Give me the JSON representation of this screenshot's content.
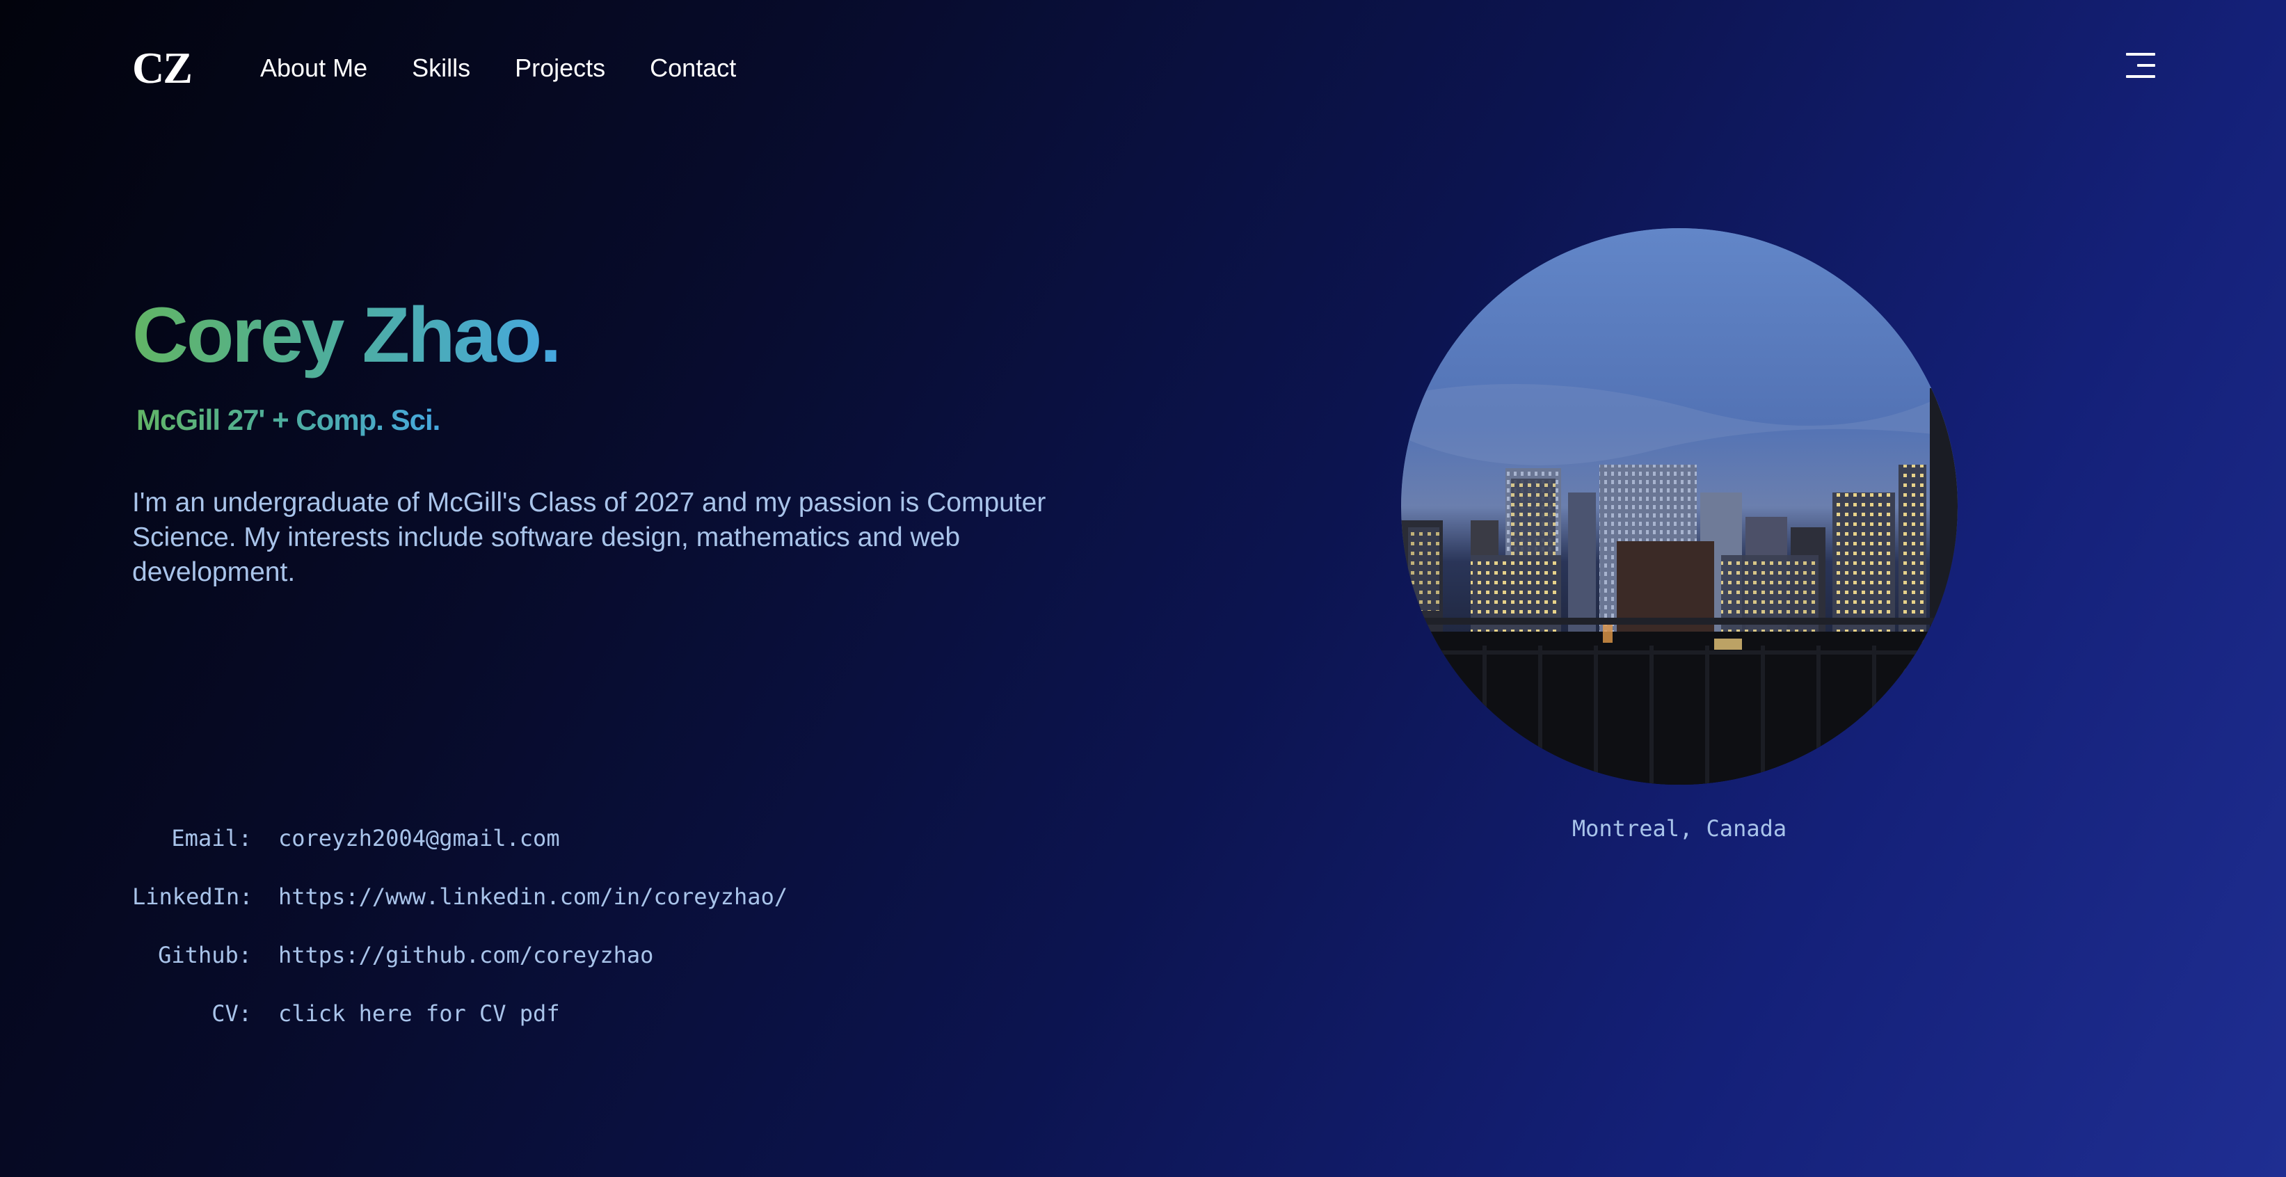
{
  "header": {
    "logo": "CZ",
    "nav": [
      "About Me",
      "Skills",
      "Projects",
      "Contact"
    ],
    "menu_icon": "hamburger-menu-icon"
  },
  "hero": {
    "name": "Corey Zhao.",
    "subtitle": "McGill 27' + Comp. Sci.",
    "bio": "I'm an undergraduate of McGill's Class of 2027 and my passion is Computer Science. My interests include software design, mathematics and web development."
  },
  "contact": [
    {
      "label": "Email:",
      "value": "coreyzh2004@gmail.com"
    },
    {
      "label": "LinkedIn:",
      "value": "https://www.linkedin.com/in/coreyzhao/"
    },
    {
      "label": "Github:",
      "value": "https://github.com/coreyzhao"
    },
    {
      "label": "CV:",
      "value": "click here for CV pdf"
    }
  ],
  "photo": {
    "caption": "Montreal, Canada"
  },
  "colors": {
    "accent_green": "#62b565",
    "accent_blue": "#46a8e0",
    "text_light_blue": "#a9c4ea",
    "background_dark": "#02030c",
    "background_blue": "#1f2e92"
  }
}
